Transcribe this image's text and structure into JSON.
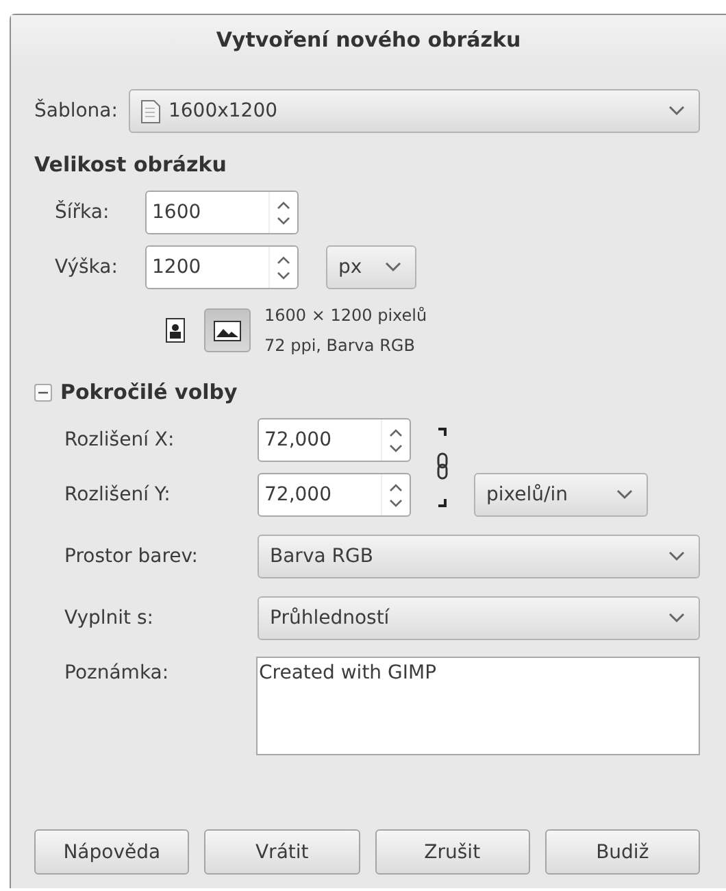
{
  "window": {
    "title": "Vytvoření nového obrázku"
  },
  "template": {
    "label": "Šablona:",
    "value": "1600x1200"
  },
  "size": {
    "heading": "Velikost obrázku",
    "width": {
      "label": "Šířka:",
      "value": "1600"
    },
    "height": {
      "label": "Výška:",
      "value": "1200"
    },
    "unit": "px",
    "orientation": [
      {
        "kind": "portrait",
        "selected": false
      },
      {
        "kind": "landscape",
        "selected": true
      }
    ],
    "info": [
      "1600 × 1200 pixelů",
      "72 ppi, Barva RGB"
    ]
  },
  "advanced": {
    "label": "Pokročilé volby",
    "expanded": true,
    "res_x": {
      "label": "Rozlišení X:",
      "value": "72,000"
    },
    "res_y": {
      "label": "Rozlišení Y:",
      "value": "72,000"
    },
    "chain_linked": true,
    "res_unit": "pixelů/in",
    "color_space": {
      "label": "Prostor barev:",
      "value": "Barva RGB"
    },
    "fill": {
      "label": "Vyplnit s:",
      "value": "Průhledností"
    },
    "comment": {
      "label": "Poznámka:",
      "value": "Created with GIMP"
    }
  },
  "buttons": [
    "Nápověda",
    "Vrátit",
    "Zrušit",
    "Budiž"
  ]
}
